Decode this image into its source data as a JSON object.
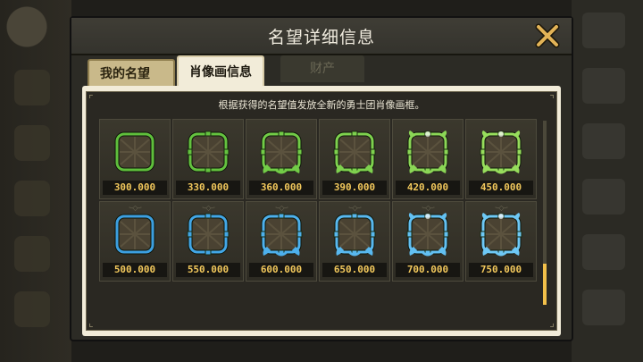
{
  "modal": {
    "title": "名望详细信息"
  },
  "tabs": [
    {
      "label": "我的名望",
      "state": "inactive"
    },
    {
      "label": "肖像画信息",
      "state": "active"
    },
    {
      "label": "财产",
      "state": "disabled"
    }
  ],
  "panel": {
    "description": "根据获得的名望值发放全新的勇士团肖像画框。"
  },
  "frames": [
    {
      "value": "300.000",
      "color": "#5fbf3c",
      "style": "plain"
    },
    {
      "value": "330.000",
      "color": "#64c23f",
      "style": "studded"
    },
    {
      "value": "360.000",
      "color": "#72cc47",
      "style": "leaf"
    },
    {
      "value": "390.000",
      "color": "#7ed14e",
      "style": "leaf"
    },
    {
      "value": "420.000",
      "color": "#8bd656",
      "style": "ornate"
    },
    {
      "value": "450.000",
      "color": "#97dd5c",
      "style": "ornate"
    },
    {
      "value": "500.000",
      "color": "#3c9fe0",
      "style": "plain"
    },
    {
      "value": "550.000",
      "color": "#42a6e6",
      "style": "studded"
    },
    {
      "value": "600.000",
      "color": "#4db0ec",
      "style": "leaf"
    },
    {
      "value": "650.000",
      "color": "#58b8ef",
      "style": "leaf"
    },
    {
      "value": "700.000",
      "color": "#62c0f2",
      "style": "ornate"
    },
    {
      "value": "750.000",
      "color": "#6ec8f5",
      "style": "ornate"
    }
  ],
  "scrollbar": {
    "position": 1.0,
    "thumb_color": "#f2c04a"
  },
  "icons": {
    "close": "close-x-icon"
  }
}
